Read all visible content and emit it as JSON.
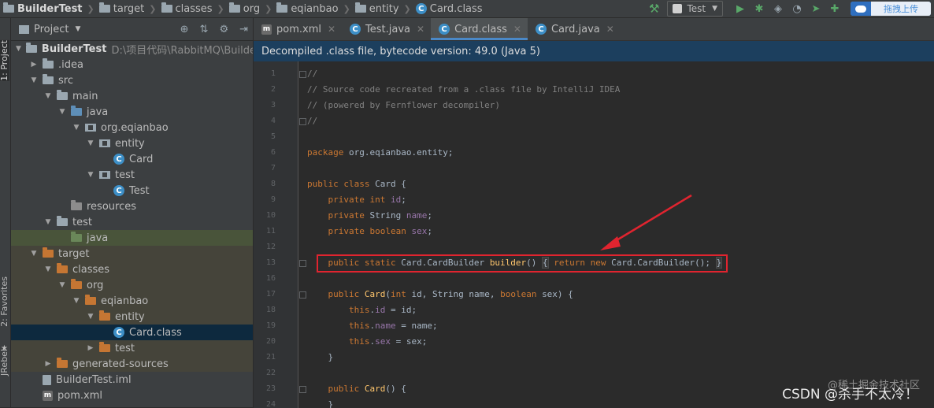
{
  "breadcrumbs": [
    {
      "label": "BuilderTest",
      "icon": "folder-icon"
    },
    {
      "label": "target",
      "icon": "folder-icon"
    },
    {
      "label": "classes",
      "icon": "folder-icon"
    },
    {
      "label": "org",
      "icon": "folder-icon"
    },
    {
      "label": "eqianbao",
      "icon": "folder-icon"
    },
    {
      "label": "entity",
      "icon": "folder-icon"
    },
    {
      "label": "Card.class",
      "icon": "class-icon"
    }
  ],
  "toolbar": {
    "run_config": "Test",
    "upload_label": "拖拽上传"
  },
  "side_tabs": {
    "project": "1: Project",
    "favorites": "2: Favorites",
    "rebel": "JRebel"
  },
  "project_panel": {
    "title": "Project",
    "rows": [
      {
        "label": "BuilderTest",
        "hint": "D:\\项目代码\\RabbitMQ\\BuilderTest",
        "depth": 0,
        "toggle": "▼",
        "icon": "module",
        "bold": true
      },
      {
        "label": ".idea",
        "hint": "",
        "depth": 1,
        "toggle": "▶",
        "icon": "folder"
      },
      {
        "label": "src",
        "hint": "",
        "depth": 1,
        "toggle": "▼",
        "icon": "folder"
      },
      {
        "label": "main",
        "hint": "",
        "depth": 2,
        "toggle": "▼",
        "icon": "folder"
      },
      {
        "label": "java",
        "hint": "",
        "depth": 3,
        "toggle": "▼",
        "icon": "folder-blue"
      },
      {
        "label": "org.eqianbao",
        "hint": "",
        "depth": 4,
        "toggle": "▼",
        "icon": "package"
      },
      {
        "label": "entity",
        "hint": "",
        "depth": 5,
        "toggle": "▼",
        "icon": "package"
      },
      {
        "label": "Card",
        "hint": "",
        "depth": 6,
        "toggle": "",
        "icon": "class"
      },
      {
        "label": "test",
        "hint": "",
        "depth": 5,
        "toggle": "▼",
        "icon": "package"
      },
      {
        "label": "Test",
        "hint": "",
        "depth": 6,
        "toggle": "",
        "icon": "class"
      },
      {
        "label": "resources",
        "hint": "",
        "depth": 3,
        "toggle": "",
        "icon": "resources"
      },
      {
        "label": "test",
        "hint": "",
        "depth": 2,
        "toggle": "▼",
        "icon": "folder"
      },
      {
        "label": "java",
        "hint": "",
        "depth": 3,
        "toggle": "",
        "icon": "folder-green",
        "highlight": "green"
      },
      {
        "label": "target",
        "hint": "",
        "depth": 1,
        "toggle": "▼",
        "icon": "folder-orange",
        "highlight": "olive"
      },
      {
        "label": "classes",
        "hint": "",
        "depth": 2,
        "toggle": "▼",
        "icon": "folder-orange",
        "highlight": "olive"
      },
      {
        "label": "org",
        "hint": "",
        "depth": 3,
        "toggle": "▼",
        "icon": "folder-orange",
        "highlight": "olive"
      },
      {
        "label": "eqianbao",
        "hint": "",
        "depth": 4,
        "toggle": "▼",
        "icon": "folder-orange",
        "highlight": "olive"
      },
      {
        "label": "entity",
        "hint": "",
        "depth": 5,
        "toggle": "▼",
        "icon": "folder-orange",
        "highlight": "olive"
      },
      {
        "label": "Card.class",
        "hint": "",
        "depth": 6,
        "toggle": "",
        "icon": "class",
        "selected": true
      },
      {
        "label": "test",
        "hint": "",
        "depth": 5,
        "toggle": "▶",
        "icon": "folder-orange",
        "highlight": "olive"
      },
      {
        "label": "generated-sources",
        "hint": "",
        "depth": 2,
        "toggle": "▶",
        "icon": "folder-orange",
        "highlight": "olive"
      },
      {
        "label": "BuilderTest.iml",
        "hint": "",
        "depth": 1,
        "toggle": "",
        "icon": "file"
      },
      {
        "label": "pom.xml",
        "hint": "",
        "depth": 1,
        "toggle": "",
        "icon": "maven"
      }
    ]
  },
  "tabs": [
    {
      "label": "pom.xml",
      "icon": "maven",
      "active": false
    },
    {
      "label": "Test.java",
      "icon": "class",
      "active": false
    },
    {
      "label": "Card.class",
      "icon": "class",
      "active": true
    },
    {
      "label": "Card.java",
      "icon": "class",
      "active": false
    }
  ],
  "notice": "Decompiled .class file, bytecode version: 49.0 (Java 5)",
  "code_lines": [
    {
      "n": "1",
      "fold": true,
      "parts": [
        [
          "cmt",
          "//"
        ]
      ]
    },
    {
      "n": "2",
      "parts": [
        [
          "cmt",
          "// Source code recreated from a .class file by IntelliJ IDEA"
        ]
      ]
    },
    {
      "n": "3",
      "parts": [
        [
          "cmt",
          "// (powered by Fernflower decompiler)"
        ]
      ]
    },
    {
      "n": "4",
      "fold": true,
      "parts": [
        [
          "cmt",
          "//"
        ]
      ]
    },
    {
      "n": "5",
      "parts": []
    },
    {
      "n": "6",
      "parts": [
        [
          "kw",
          "package "
        ],
        [
          "",
          "org.eqianbao.entity;"
        ]
      ]
    },
    {
      "n": "7",
      "parts": []
    },
    {
      "n": "8",
      "parts": [
        [
          "kw",
          "public class "
        ],
        [
          "",
          "Card {"
        ]
      ]
    },
    {
      "n": "9",
      "parts": [
        [
          "",
          "    "
        ],
        [
          "kw",
          "private int "
        ],
        [
          "fld",
          "id"
        ],
        [
          "",
          ";"
        ]
      ]
    },
    {
      "n": "10",
      "parts": [
        [
          "",
          "    "
        ],
        [
          "kw",
          "private "
        ],
        [
          "",
          "String "
        ],
        [
          "fld",
          "name"
        ],
        [
          "",
          ";"
        ]
      ]
    },
    {
      "n": "11",
      "parts": [
        [
          "",
          "    "
        ],
        [
          "kw",
          "private boolean "
        ],
        [
          "fld",
          "sex"
        ],
        [
          "",
          ";"
        ]
      ]
    },
    {
      "n": "12",
      "parts": []
    },
    {
      "n": "13",
      "fold": true,
      "parts": [
        [
          "",
          "    "
        ],
        [
          "kw",
          "public static "
        ],
        [
          "",
          "Card.CardBuilder "
        ],
        [
          "fn",
          "builder"
        ],
        [
          "",
          "() "
        ],
        [
          "brace",
          "{"
        ],
        [
          "",
          " "
        ],
        [
          "kw",
          "return new "
        ],
        [
          "",
          "Card.CardBuilder(); "
        ],
        [
          "brace",
          "}"
        ]
      ]
    },
    {
      "n": "16",
      "parts": []
    },
    {
      "n": "17",
      "fold": true,
      "parts": [
        [
          "",
          "    "
        ],
        [
          "kw",
          "public "
        ],
        [
          "fn",
          "Card"
        ],
        [
          "",
          "("
        ],
        [
          "kw",
          "int "
        ],
        [
          "",
          "id, String name, "
        ],
        [
          "kw",
          "boolean "
        ],
        [
          "",
          "sex) {"
        ]
      ]
    },
    {
      "n": "18",
      "parts": [
        [
          "",
          "        "
        ],
        [
          "kw",
          "this"
        ],
        [
          "",
          "."
        ],
        [
          "fld",
          "id"
        ],
        [
          "",
          " = id;"
        ]
      ]
    },
    {
      "n": "19",
      "parts": [
        [
          "",
          "        "
        ],
        [
          "kw",
          "this"
        ],
        [
          "",
          "."
        ],
        [
          "fld",
          "name"
        ],
        [
          "",
          " = name;"
        ]
      ]
    },
    {
      "n": "20",
      "parts": [
        [
          "",
          "        "
        ],
        [
          "kw",
          "this"
        ],
        [
          "",
          "."
        ],
        [
          "fld",
          "sex"
        ],
        [
          "",
          " = sex;"
        ]
      ]
    },
    {
      "n": "21",
      "parts": [
        [
          "",
          "    }"
        ]
      ]
    },
    {
      "n": "22",
      "parts": []
    },
    {
      "n": "23",
      "fold": true,
      "parts": [
        [
          "",
          "    "
        ],
        [
          "kw",
          "public "
        ],
        [
          "fn",
          "Card"
        ],
        [
          "",
          "() {"
        ]
      ]
    },
    {
      "n": "24",
      "parts": [
        [
          "",
          "    }"
        ]
      ]
    }
  ],
  "watermark": "CSDN @杀手不太冷！",
  "watermark_bg": "@稀土掘金技术社区",
  "colors": {
    "annotation_red": "#e0242f",
    "tab_accent": "#4a88c7",
    "notice_bg": "#1c3f5e"
  }
}
